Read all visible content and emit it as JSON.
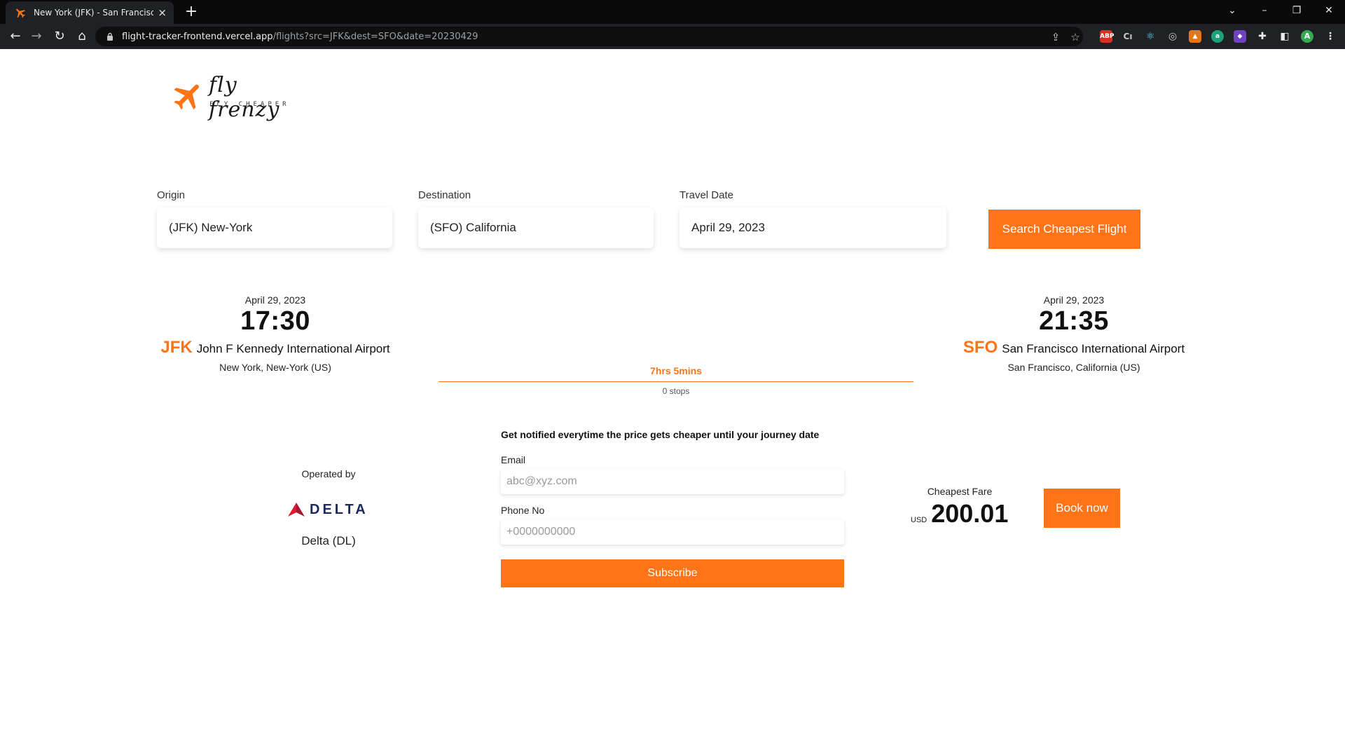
{
  "browser": {
    "tab_title": "New York (JFK) - San Francisco (SFO)",
    "tab_close": "×",
    "new_tab": "+",
    "url_host": "flight-tracker-frontend.vercel.app",
    "url_path": "/flights?src=JFK&dest=SFO&date=20230429",
    "ext_abp": "ABP",
    "profile_initial": "A"
  },
  "brand": {
    "name": "fly frenzy",
    "tagline": "FLY CHEAPER",
    "accent_color": "#ff7417"
  },
  "search": {
    "origin_label": "Origin",
    "origin_value": "(JFK) New-York",
    "destination_label": "Destination",
    "destination_value": "(SFO) California",
    "date_label": "Travel Date",
    "date_value": "April 29, 2023",
    "button_label": "Search Cheapest Flight"
  },
  "flight": {
    "departure": {
      "date": "April 29, 2023",
      "time": "17:30",
      "code": "JFK",
      "airport": "John F Kennedy International Airport",
      "city": "New York, New-York (US)"
    },
    "arrival": {
      "date": "April 29, 2023",
      "time": "21:35",
      "code": "SFO",
      "airport": "San Francisco International Airport",
      "city": "San Francisco, California (US)"
    },
    "duration": "7hrs 5mins",
    "stops": "0 stops"
  },
  "airline": {
    "operated_label": "Operated by",
    "logo_text": "DELTA",
    "name": "Delta (DL)"
  },
  "subscribe": {
    "heading": "Get notified everytime the price gets cheaper until your journey date",
    "email_label": "Email",
    "email_placeholder": "abc@xyz.com",
    "phone_label": "Phone No",
    "phone_placeholder": "+0000000000",
    "button_label": "Subscribe"
  },
  "fare": {
    "label": "Cheapest Fare",
    "currency": "USD",
    "amount": "200.01",
    "book_label": "Book now"
  }
}
